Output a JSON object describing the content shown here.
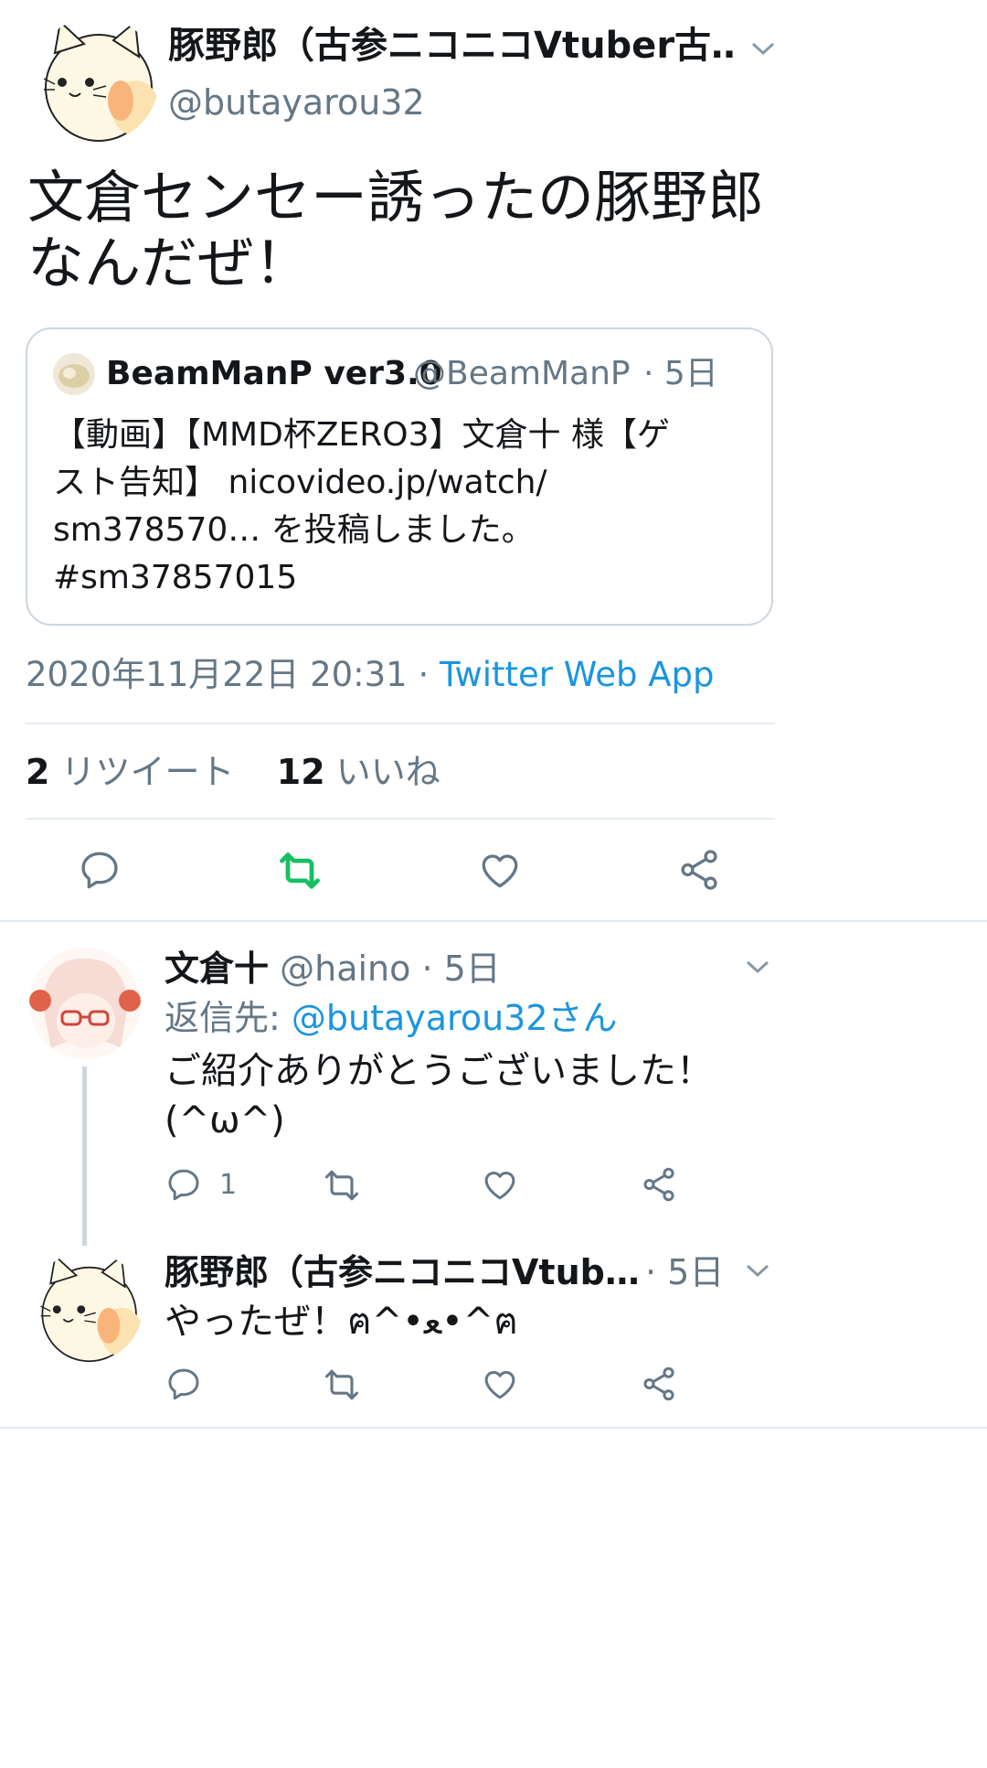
{
  "main_tweet": {
    "author_name": "豚野郎（古参ニコニコVtuber古…",
    "author_handle": "@butayarou32",
    "avatar_icon": "cat-mascot-avatar",
    "text_line1": "文倉センセー誘ったの豚野郎",
    "text_line2": "なんだぜ！",
    "quoted": {
      "author_name": "BeamManP ver3.0",
      "author_handle": "@BeamManP",
      "time": "· 5日",
      "line1": "【動画】【MMD杯ZERO3】文倉十 様【ゲ",
      "line2": "スト告知】 nicovideo.jp/watch/",
      "line3": "sm378570… を投稿しました。",
      "line4": "#sm37857015"
    },
    "timestamp": "2020年11月22日 20:31",
    "separator": " · ",
    "source": "Twitter Web App",
    "retweet_count": "2",
    "retweet_label": "リツイート",
    "like_count": "12",
    "like_label": "いいね",
    "action_icons": [
      "reply-icon",
      "retweet-icon",
      "like-icon",
      "share-icon"
    ]
  },
  "replies": [
    {
      "author_name": "文倉十",
      "author_handle": "@haino",
      "time": "· 5日",
      "reply_to_label": "返信先: ",
      "reply_to_user": "@butayarou32さん",
      "line1": "ご紹介ありがとうございました！",
      "line2": "(^ω^)",
      "reply_count": "1"
    },
    {
      "author_name": "豚野郎（古参ニコニコVtub…",
      "time": "· 5日",
      "line1": "やったぜ！ฅ^•ﻌ•^ฅ"
    }
  ],
  "colors": {
    "accent": "#1b95e0",
    "retweet_green": "#17bf63",
    "secondary_text": "#657786",
    "divider": "#e6ecf0"
  }
}
